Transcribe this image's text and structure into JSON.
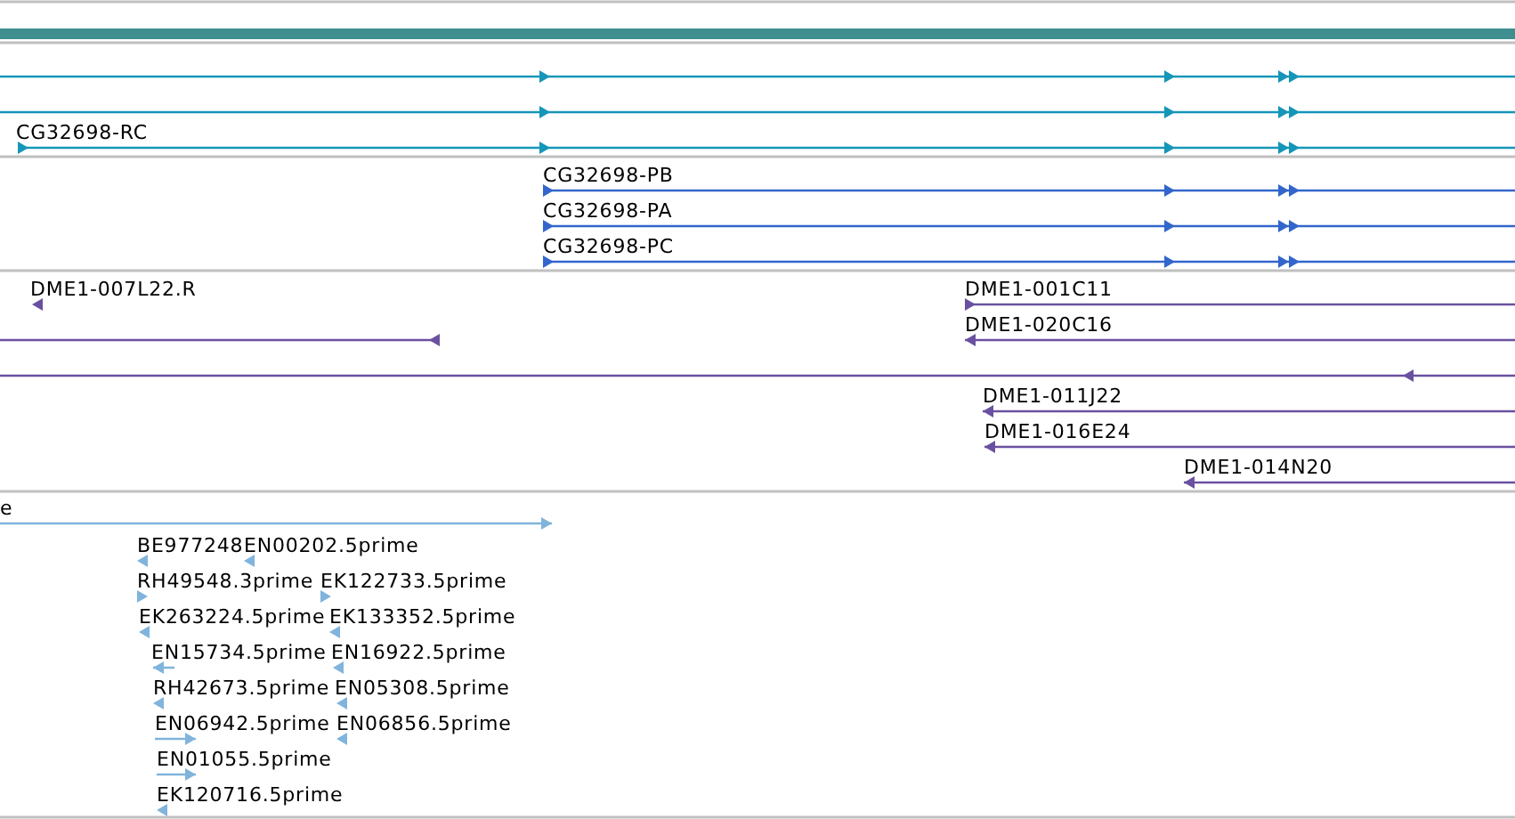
{
  "tracks": [
    {
      "kind": "bar",
      "color": "#3f8f8f"
    },
    {
      "kind": "features",
      "color": "#1596b8",
      "features": [
        {
          "reverse": false
        },
        {
          "reverse": false
        },
        {
          "label": "CG32698-RC",
          "reverse": false
        }
      ]
    },
    {
      "kind": "features",
      "color": "#3366cc",
      "features": [
        {
          "label": "CG32698-PB",
          "reverse": false
        },
        {
          "label": "CG32698-PA",
          "reverse": false
        },
        {
          "label": "CG32698-PC",
          "reverse": false
        }
      ]
    },
    {
      "kind": "features",
      "color": "#6a50a0",
      "features": [
        {
          "label": "DME1-007L22.R",
          "reverse": true
        },
        {
          "reverse": true
        },
        {
          "reverse": true
        },
        {
          "label": "DME1-001C11",
          "reverse": false
        },
        {
          "label": "DME1-020C16",
          "reverse": true
        },
        {
          "label": "DME1-011J22",
          "reverse": true
        },
        {
          "label": "DME1-016E24",
          "reverse": true
        },
        {
          "label": "DME1-014N20",
          "reverse": true
        }
      ]
    },
    {
      "kind": "features",
      "color": "#80b4dc",
      "features": [
        {
          "label": "e",
          "reverse": false
        },
        {
          "label": "BE977248",
          "reverse": true
        },
        {
          "label": "EN00202.5prime",
          "reverse": true
        },
        {
          "label": "RH49548.3prime",
          "reverse": false
        },
        {
          "label": "EK122733.5prime",
          "reverse": false
        },
        {
          "label": "EK263224.5prime",
          "reverse": true
        },
        {
          "label": "EK133352.5prime",
          "reverse": true
        },
        {
          "label": "EN15734.5prime",
          "reverse": true
        },
        {
          "label": "EN16922.5prime",
          "reverse": true
        },
        {
          "label": "RH42673.5prime",
          "reverse": true
        },
        {
          "label": "EN05308.5prime",
          "reverse": true
        },
        {
          "label": "EN06942.5prime",
          "reverse": false
        },
        {
          "label": "EN06856.5prime",
          "reverse": true
        },
        {
          "label": "EN01055.5prime",
          "reverse": false
        },
        {
          "label": "EK120716.5prime",
          "reverse": true
        }
      ]
    }
  ]
}
